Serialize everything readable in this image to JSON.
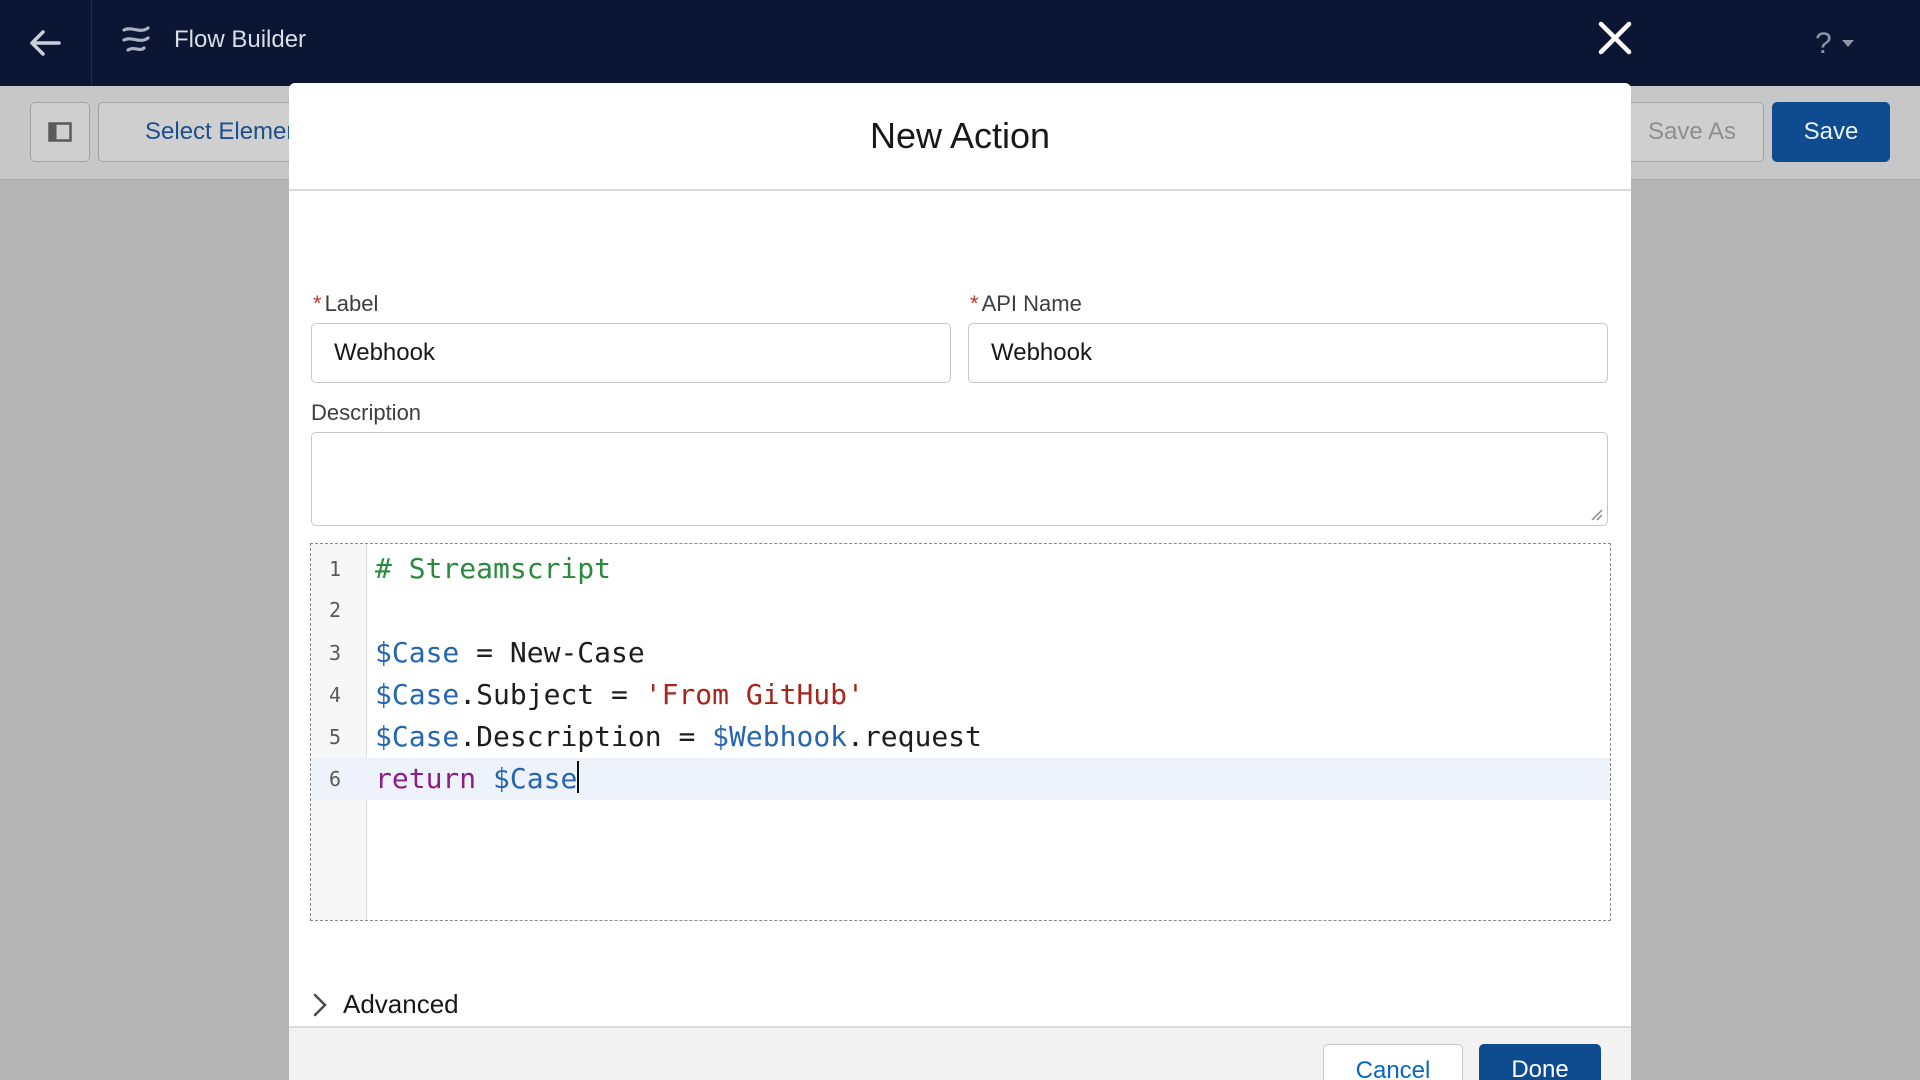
{
  "header": {
    "app_title": "Flow Builder",
    "help_label": "?"
  },
  "toolbar": {
    "select_elements_label": "Select Elements",
    "save_as_label": "Save As",
    "save_label": "Save"
  },
  "modal": {
    "title": "New Action",
    "label_field": {
      "label": "Label",
      "required_mark": "*",
      "value": "Webhook"
    },
    "api_name_field": {
      "label": "API Name",
      "required_mark": "*",
      "value": "Webhook"
    },
    "description_field": {
      "label": "Description",
      "value": ""
    },
    "editor": {
      "line_numbers": [
        "1",
        "2",
        "3",
        "4",
        "5",
        "6"
      ],
      "active_line": 6,
      "lines": [
        {
          "comment": "# Streamscript"
        },
        {},
        {
          "var": "$Case",
          "text": " = New-Case"
        },
        {
          "var": "$Case",
          "text": ".Subject = ",
          "string": "'From GitHub'"
        },
        {
          "var": "$Case",
          "text": ".Description = ",
          "var2": "$Webhook",
          "text2": ".request"
        },
        {
          "keyword": "return",
          "space": " ",
          "var": "$Case"
        }
      ]
    },
    "advanced_label": "Advanced",
    "footer": {
      "cancel_label": "Cancel",
      "done_label": "Done"
    }
  },
  "icons": {
    "back": "arrow-left-icon",
    "app": "flow-icon",
    "close": "close-icon",
    "help": "help-icon",
    "panel": "panel-toggle-icon",
    "select": "checkbox-icon",
    "advanced": "chevron-right-icon"
  },
  "colors": {
    "topbar": "#0a1633",
    "brand_button": "#0e4b8f",
    "required": "#c23934",
    "comment": "#2a8a3e",
    "variable": "#2566b0",
    "string": "#a5261d",
    "keyword": "#8a1f86"
  }
}
